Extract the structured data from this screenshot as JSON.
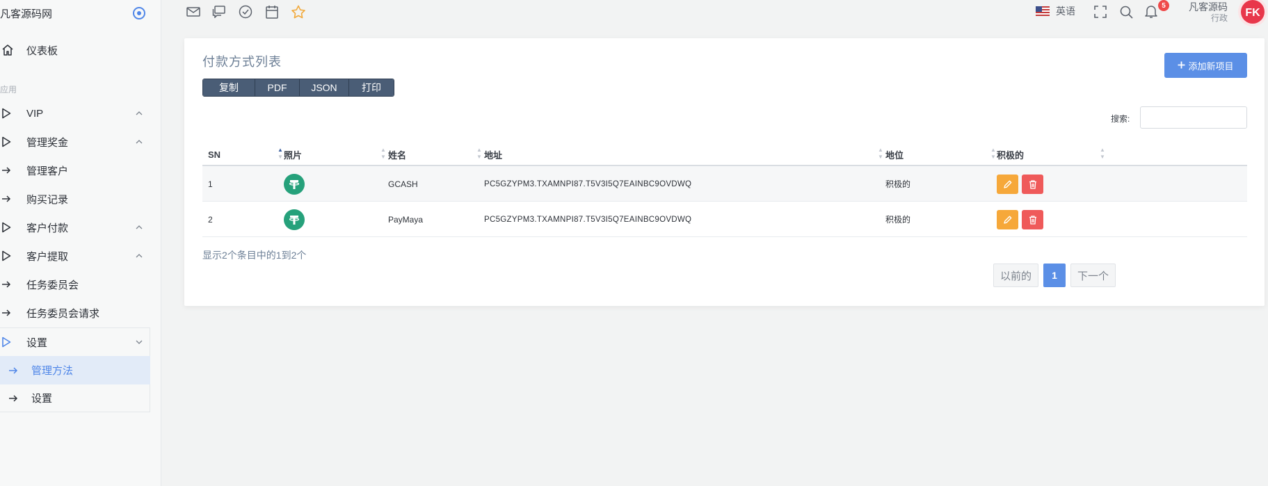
{
  "brand": {
    "name": "凡客源码网"
  },
  "sidebar": {
    "dashboard": "仪表板",
    "section_label": "应用",
    "items": [
      {
        "label": "VIP",
        "icon": "play-outline-icon",
        "chevron": "up"
      },
      {
        "label": "管理奖金",
        "icon": "play-outline-icon",
        "chevron": "up"
      },
      {
        "label": "管理客户",
        "icon": "arrow-right-icon"
      },
      {
        "label": "购买记录",
        "icon": "arrow-right-icon"
      },
      {
        "label": "客户付款",
        "icon": "play-outline-icon",
        "chevron": "up"
      },
      {
        "label": "客户提取",
        "icon": "play-outline-icon",
        "chevron": "up"
      },
      {
        "label": "任务委员会",
        "icon": "arrow-right-icon"
      },
      {
        "label": "任务委员会请求",
        "icon": "arrow-right-icon"
      },
      {
        "label": "设置",
        "icon": "play-outline-icon",
        "chevron": "down"
      }
    ],
    "submenu": [
      {
        "label": "管理方法",
        "active": true
      },
      {
        "label": "设置",
        "active": false
      }
    ]
  },
  "topbar": {
    "language": "英语",
    "notification_count": "5",
    "user_name": "凡客源码",
    "user_role": "行政",
    "avatar_text": "FK"
  },
  "card": {
    "title": "付款方式列表",
    "export_buttons": [
      "复制",
      "PDF",
      "JSON",
      "打印"
    ],
    "add_button": "添加新项目",
    "search_label": "搜索:",
    "columns": [
      "SN",
      "照片",
      "姓名",
      "地址",
      "地位",
      "积极的"
    ],
    "rows": [
      {
        "sn": "1",
        "name": "GCASH",
        "address": "PC5GZYPM3.TXAMNPI87.T5V3I5Q7EAINBC9OVDWQ",
        "status": "积极的"
      },
      {
        "sn": "2",
        "name": "PayMaya",
        "address": "PC5GZYPM3.TXAMNPI87.T5V3I5Q7EAINBC9OVDWQ",
        "status": "积极的"
      }
    ],
    "info": "显示2个条目中的1到2个",
    "pager": {
      "prev": "以前的",
      "current": "1",
      "next": "下一个"
    }
  },
  "colors": {
    "accent": "#5b8fe6",
    "edit": "#f6a83a",
    "delete": "#ef5a5a",
    "tether": "#26a17b"
  }
}
